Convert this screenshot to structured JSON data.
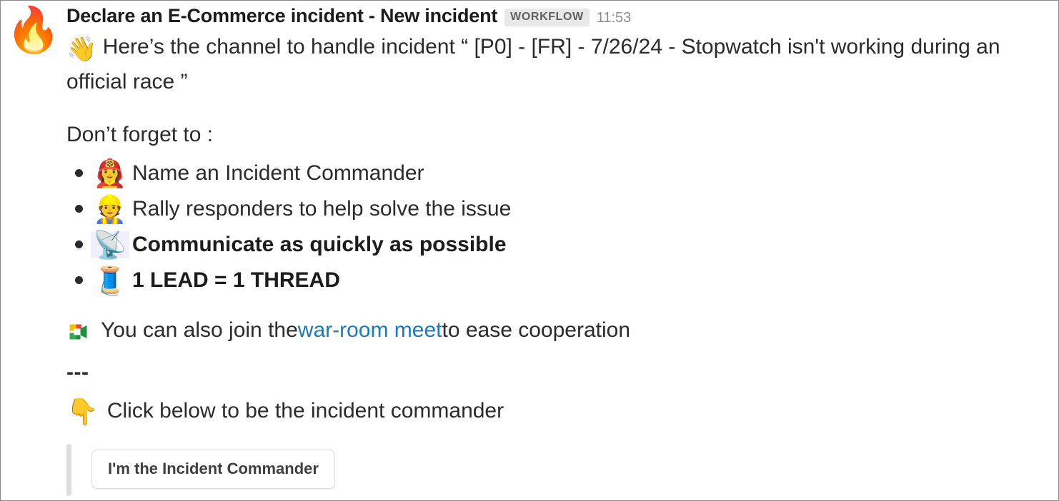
{
  "message": {
    "avatar_emoji": "🔥",
    "avatar_icon_name": "fire-emoji-avatar",
    "sender_name": "Declare an E-Commerce incident - New incident",
    "badge": "WORKFLOW",
    "timestamp": "11:53",
    "intro": {
      "emoji": "👋",
      "text": "Here’s the channel to handle incident “ [P0] - [FR] - 7/26/24 - Stopwatch isn't working during an official race ”"
    },
    "checklist_heading": "Don’t forget to :",
    "checklist": [
      {
        "emoji": "👩‍🚒",
        "label": "Name an Incident Commander",
        "bold": false,
        "boxed": false
      },
      {
        "emoji": "👷",
        "label": "Rally responders to help solve the issue",
        "bold": false,
        "boxed": false
      },
      {
        "emoji": "📡",
        "label": "Communicate as quickly as possible",
        "bold": true,
        "boxed": true
      },
      {
        "emoji": "🧵",
        "label": "1 LEAD = 1 THREAD",
        "bold": true,
        "boxed": false
      }
    ],
    "meet_line": {
      "icon_name": "google-meet-icon",
      "prefix": "You can also join the ",
      "link_text": "war-room meet",
      "suffix": " to ease cooperation"
    },
    "divider": "---",
    "cta_line": {
      "emoji": "👇",
      "text": "Click below to be the incident commander"
    },
    "action_button": {
      "label": "I'm the Incident Commander"
    }
  },
  "colors": {
    "text": "#2b2b2b",
    "heading": "#1d1c1d",
    "link": "#1d7ab8",
    "badge_bg": "#e8e8e8",
    "badge_text": "#616061",
    "timestamp": "#8d8d8d",
    "attachment_bar": "#dddddd",
    "button_border": "#dcdcdc",
    "emoji_highlight_bg": "#f0effa"
  }
}
